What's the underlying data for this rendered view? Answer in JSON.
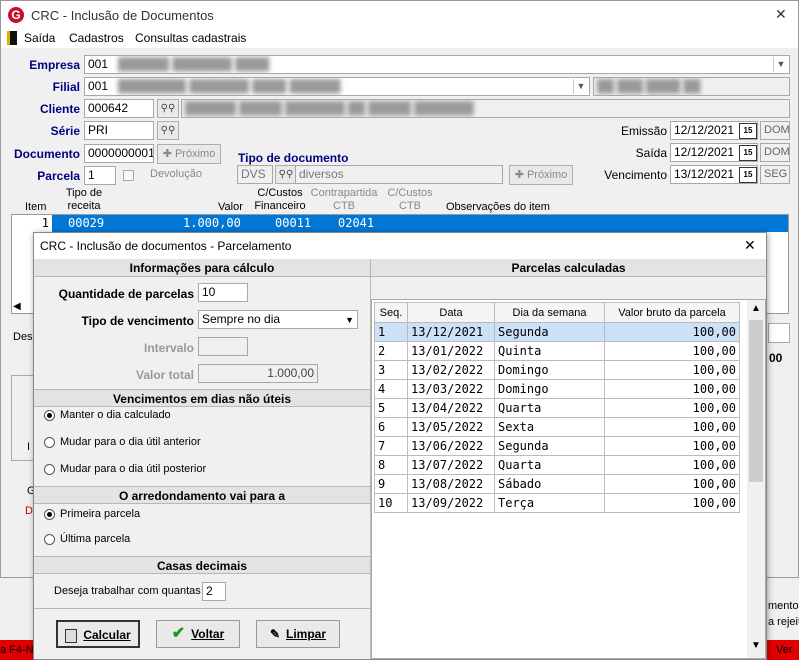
{
  "window": {
    "title": "CRC - Inclusão de Documentos",
    "close": "✕"
  },
  "menu": [
    "Saída",
    "Cadastros",
    "Consultas cadastrais"
  ],
  "form": {
    "empresa_label": "Empresa",
    "empresa_value": "001",
    "filial_label": "Filial",
    "filial_value": "001",
    "cliente_label": "Cliente",
    "cliente_value": "000642",
    "serie_label": "Série",
    "serie_value": "PRI",
    "documento_label": "Documento",
    "documento_value": "0000000001",
    "proximo_label": "Próximo",
    "parcela_label": "Parcela",
    "parcela_value": "1",
    "devolucao_label": "Devolução",
    "tipo_doc_label": "Tipo de documento",
    "tipo_doc_code": "DVS",
    "tipo_doc_desc": "diversos",
    "emissao_label": "Emissão",
    "emissao_value": "12/12/2021",
    "emissao_dow": "DOM",
    "saida_label": "Saída",
    "saida_value": "12/12/2021",
    "saida_dow": "DOM",
    "vencimento_label": "Vencimento",
    "vencimento_value": "13/12/2021",
    "vencimento_dow": "SEG",
    "cal_icon": "15"
  },
  "items": {
    "headers": {
      "item": "Item",
      "tipo": "Tipo de receita",
      "valor": "Valor",
      "cc": "C/Custos Financeiro",
      "contra": "Contrapartida CTB",
      "ccctb": "C/Custos CTB",
      "obs": "Observações do item"
    },
    "row": {
      "item": "1",
      "tipo": "00029",
      "valor": "1.000,00",
      "cc": "00011",
      "contra": "02041"
    }
  },
  "background_fragments": {
    "des": "Des",
    "val00": "00",
    "i1": "I",
    "i2": "I",
    "g": "G",
    "d": "D",
    "mento": "mento na",
    "rejeit": "a rejeit",
    "f4": "a F4-N",
    "ver": "Ver"
  },
  "dialog": {
    "title": "CRC - Inclusão de documentos - Parcelamento",
    "info_head": "Informações para cálculo",
    "qtd_label": "Quantidade de parcelas",
    "qtd_value": "10",
    "tipo_venc_label": "Tipo de vencimento",
    "tipo_venc_value": "Sempre no dia",
    "intervalo_label": "Intervalo",
    "valor_total_label": "Valor total",
    "valor_total_value": "1.000,00",
    "venc_head": "Vencimentos em dias não úteis",
    "venc_opts": [
      "Manter o dia calculado",
      "Mudar para o dia útil anterior",
      "Mudar para o dia útil posterior"
    ],
    "arred_head": "O arredondamento vai para a",
    "arred_opts": [
      "Primeira parcela",
      "Última parcela"
    ],
    "casas_head": "Casas decimais",
    "casas_label": "Deseja trabalhar com quantas",
    "casas_value": "2",
    "btn_calcular": "Calcular",
    "btn_voltar": "Voltar",
    "btn_limpar": "Limpar",
    "parcelas_head": "Parcelas calculadas",
    "cols": [
      "Seq.",
      "Data",
      "Dia da semana",
      "Valor bruto da parcela"
    ],
    "rows": [
      [
        "1",
        "13/12/2021",
        "Segunda",
        "100,00"
      ],
      [
        "2",
        "13/01/2022",
        "Quinta",
        "100,00"
      ],
      [
        "3",
        "13/02/2022",
        "Domingo",
        "100,00"
      ],
      [
        "4",
        "13/03/2022",
        "Domingo",
        "100,00"
      ],
      [
        "5",
        "13/04/2022",
        "Quarta",
        "100,00"
      ],
      [
        "6",
        "13/05/2022",
        "Sexta",
        "100,00"
      ],
      [
        "7",
        "13/06/2022",
        "Segunda",
        "100,00"
      ],
      [
        "8",
        "13/07/2022",
        "Quarta",
        "100,00"
      ],
      [
        "9",
        "13/08/2022",
        "Sábado",
        "100,00"
      ],
      [
        "10",
        "13/09/2022",
        "Terça",
        "100,00"
      ]
    ]
  }
}
